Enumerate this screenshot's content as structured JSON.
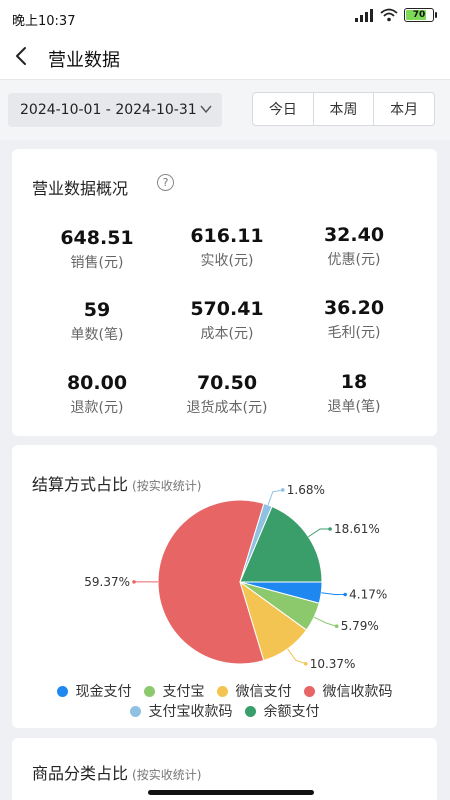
{
  "status": {
    "time": "晚上10:37",
    "battery": "70"
  },
  "header": {
    "title": "营业数据"
  },
  "filter": {
    "date_range": "2024-10-01 - 2024-10-31",
    "segments": [
      "今日",
      "本周",
      "本月"
    ]
  },
  "overview": {
    "title": "营业数据概况",
    "metrics": [
      {
        "value": "648.51",
        "label": "销售(元)"
      },
      {
        "value": "616.11",
        "label": "实收(元)"
      },
      {
        "value": "32.40",
        "label": "优惠(元)"
      },
      {
        "value": "59",
        "label": "单数(笔)"
      },
      {
        "value": "570.41",
        "label": "成本(元)"
      },
      {
        "value": "36.20",
        "label": "毛利(元)"
      },
      {
        "value": "80.00",
        "label": "退款(元)"
      },
      {
        "value": "70.50",
        "label": "退货成本(元)"
      },
      {
        "value": "18",
        "label": "退单(笔)"
      }
    ]
  },
  "payment": {
    "title": "结算方式占比",
    "subtitle": "(按实收统计)"
  },
  "category": {
    "title": "商品分类占比",
    "subtitle": "(按实收统计)"
  },
  "chart_data": {
    "type": "pie",
    "slices": [
      {
        "name": "现金支付",
        "value": 4.17,
        "label": "4.17%",
        "color": "#1e88f0"
      },
      {
        "name": "支付宝",
        "value": 5.79,
        "label": "5.79%",
        "color": "#8cc96c"
      },
      {
        "name": "微信支付",
        "value": 10.37,
        "label": "10.37%",
        "color": "#f4c453"
      },
      {
        "name": "微信收款码",
        "value": 59.37,
        "label": "59.37%",
        "color": "#e86565"
      },
      {
        "name": "支付宝收款码",
        "value": 1.68,
        "label": "1.68%",
        "color": "#8fc1e3"
      },
      {
        "name": "余额支付",
        "value": 18.61,
        "label": "18.61%",
        "color": "#3a9e6b"
      }
    ],
    "legend_position": "bottom"
  }
}
